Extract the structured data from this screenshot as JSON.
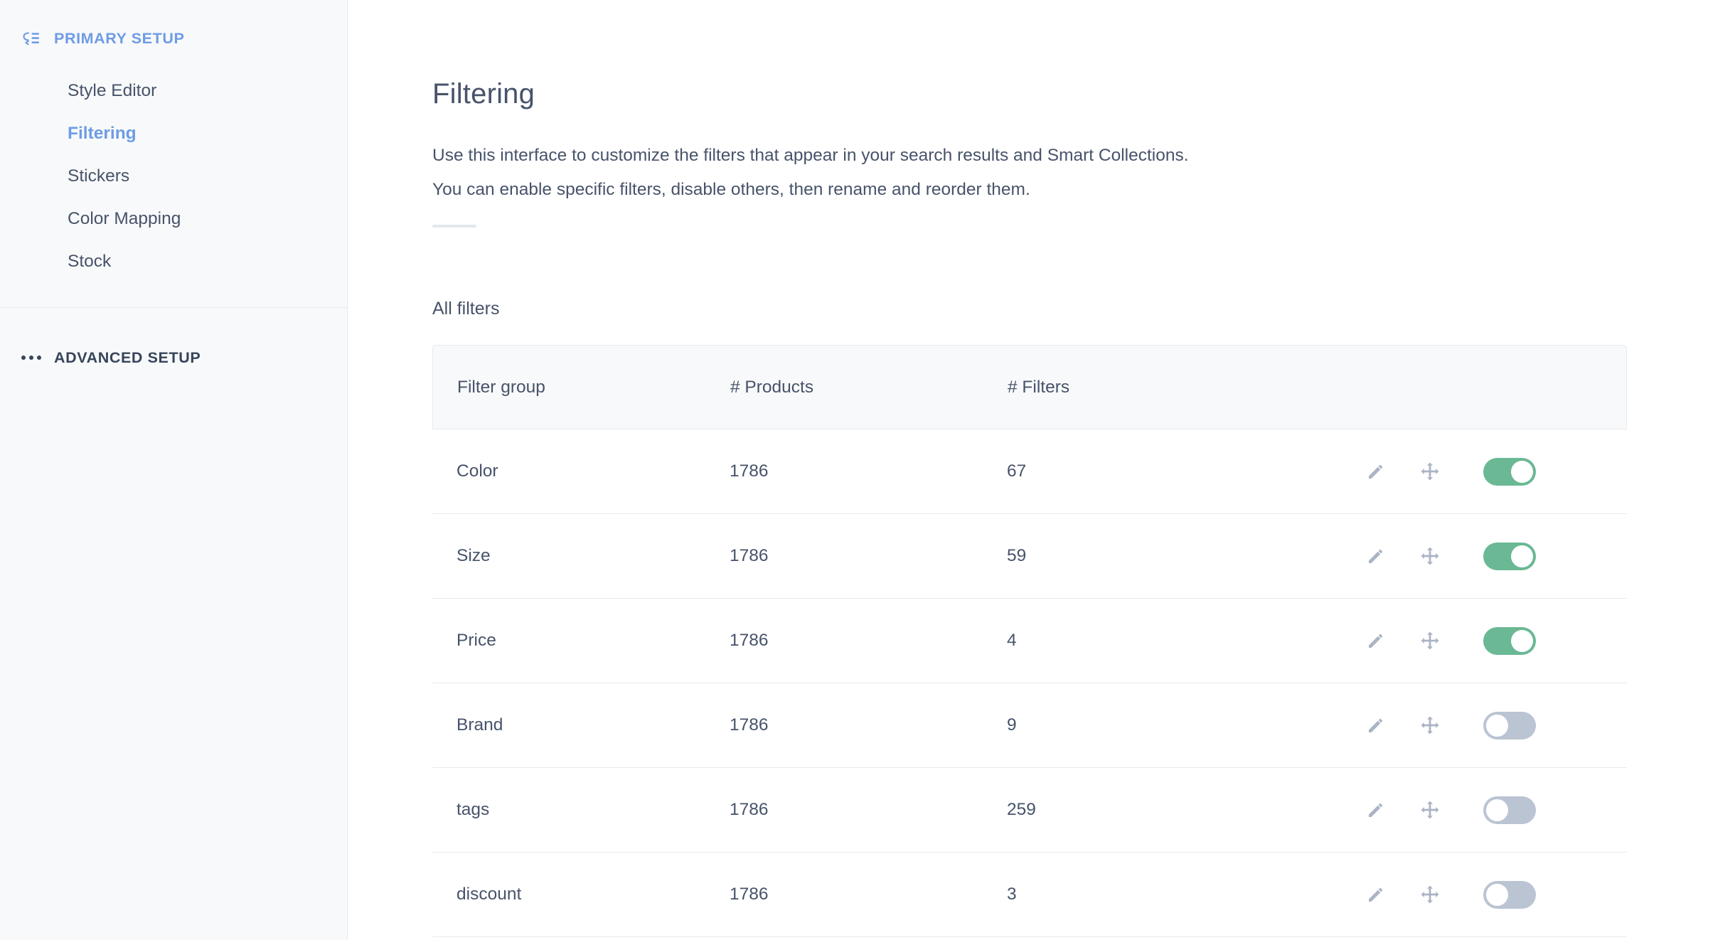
{
  "sidebar": {
    "primary": {
      "icon": "filter-list-icon",
      "label": "PRIMARY SETUP",
      "items": [
        {
          "label": "Style Editor",
          "active": false
        },
        {
          "label": "Filtering",
          "active": true
        },
        {
          "label": "Stickers",
          "active": false
        },
        {
          "label": "Color Mapping",
          "active": false
        },
        {
          "label": "Stock",
          "active": false
        }
      ]
    },
    "advanced": {
      "icon": "ellipsis-icon",
      "label": "ADVANCED SETUP"
    }
  },
  "main": {
    "title": "Filtering",
    "description_line1": "Use this interface to customize the filters that appear in your search results and Smart Collections.",
    "description_line2": "You can enable specific filters, disable others, then rename and reorder them.",
    "section_title": "All filters",
    "table": {
      "columns": [
        "Filter group",
        "# Products",
        "# Filters"
      ],
      "rows": [
        {
          "name": "Color",
          "products": "1786",
          "filters": "67",
          "enabled": true
        },
        {
          "name": "Size",
          "products": "1786",
          "filters": "59",
          "enabled": true
        },
        {
          "name": "Price",
          "products": "1786",
          "filters": "4",
          "enabled": true
        },
        {
          "name": "Brand",
          "products": "1786",
          "filters": "9",
          "enabled": false
        },
        {
          "name": "tags",
          "products": "1786",
          "filters": "259",
          "enabled": false
        },
        {
          "name": "discount",
          "products": "1786",
          "filters": "3",
          "enabled": false
        }
      ],
      "row_actions": {
        "edit_icon": "pencil-icon",
        "reorder_icon": "move-arrows-icon",
        "toggle": "enable-toggle"
      }
    }
  },
  "colors": {
    "accent_blue": "#6e9ce6",
    "text_dark": "#47536a",
    "toggle_on": "#6ab894",
    "toggle_off": "#bac4d2",
    "sidebar_bg": "#f8f9fa",
    "border": "#e7eaee"
  }
}
